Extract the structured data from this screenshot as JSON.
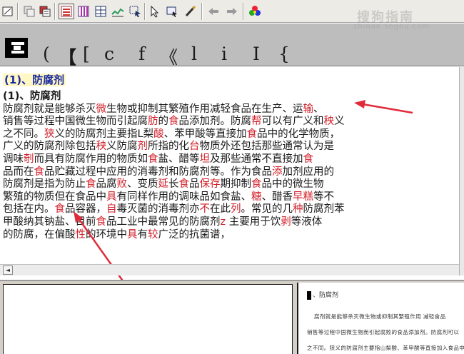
{
  "toolbar": {
    "buttons": [
      "frame-icon",
      "grid-icon",
      "grid-red-icon",
      "list-red-icon",
      "table-purple-icon",
      "table-blue-icon",
      "chart-icon",
      "select-icon",
      "pointer-icon",
      "region-icon",
      "pen-icon",
      "arrow-left-icon",
      "arrow-right-icon",
      "color-palette-icon"
    ]
  },
  "char_strip": {
    "chars": [
      "(",
      "【",
      "[",
      "c",
      "f",
      "《",
      "l",
      "i",
      "I",
      "{"
    ]
  },
  "text_pane": {
    "heading": "(1)、防腐剂",
    "subheading": "(1)、防腐剂",
    "lines": [
      [
        {
          "t": "    防腐剂就是能够杀灭"
        },
        {
          "t": "微",
          "r": true
        },
        {
          "t": "生物或抑制其繁殖作用减轻食品在生产、运"
        },
        {
          "t": "输",
          "r": true
        },
        {
          "t": "、"
        }
      ],
      [
        {
          "t": "销售等过程中国微生物而引起腐"
        },
        {
          "t": "肪",
          "r": true
        },
        {
          "t": "的"
        },
        {
          "t": "食",
          "r": true
        },
        {
          "t": "品添加剂。防腐"
        },
        {
          "t": "帮",
          "r": true
        },
        {
          "t": "可以有广义和"
        },
        {
          "t": "秧",
          "r": true
        },
        {
          "t": "义"
        }
      ],
      [
        {
          "t": "之不同。"
        },
        {
          "t": "狭",
          "r": true
        },
        {
          "t": "义的防腐剂主要指L梨"
        },
        {
          "t": "酸",
          "r": true
        },
        {
          "t": "、苯甲酸等直接加"
        },
        {
          "t": "食",
          "r": true
        },
        {
          "t": "品中的化学物质，"
        }
      ],
      [
        {
          "t": "广义的防腐剂除包括"
        },
        {
          "t": "秧",
          "r": true
        },
        {
          "t": "义防腐"
        },
        {
          "t": "剂",
          "r": true
        },
        {
          "t": "所指的化"
        },
        {
          "t": "台",
          "r": true
        },
        {
          "t": "物质外还包括那些通常认为是"
        }
      ],
      [
        {
          "t": "调味"
        },
        {
          "t": "剞",
          "r": true
        },
        {
          "t": "而具有防腐作用的物质如"
        },
        {
          "t": "食",
          "r": true
        },
        {
          "t": "盐、醋等"
        },
        {
          "t": "坦",
          "r": true
        },
        {
          "t": "及那些通常不直接加"
        },
        {
          "t": "食",
          "r": true
        }
      ],
      [
        {
          "t": "品而在"
        },
        {
          "t": "食",
          "r": true
        },
        {
          "t": "品贮藏过程中应用的消毒剂和防腐剂等。作为食品"
        },
        {
          "t": "添",
          "r": true
        },
        {
          "t": "加剂应用的"
        }
      ],
      [
        {
          "t": "防腐剂是指为防止"
        },
        {
          "t": "食",
          "r": true
        },
        {
          "t": "品腐"
        },
        {
          "t": "败",
          "r": true
        },
        {
          "t": "、变质"
        },
        {
          "t": "延",
          "r": true
        },
        {
          "t": "长"
        },
        {
          "t": "食",
          "r": true
        },
        {
          "t": "品"
        },
        {
          "t": "保存",
          "r": true
        },
        {
          "t": "期抑制"
        },
        {
          "t": "食",
          "r": true
        },
        {
          "t": "品中的微生物"
        }
      ],
      [
        {
          "t": "繁殖的物质但在食品中"
        },
        {
          "t": "具",
          "r": true
        },
        {
          "t": "有同样作用的调味品如食盐、"
        },
        {
          "t": "糖",
          "r": true
        },
        {
          "t": "、醋香"
        },
        {
          "t": "早糕",
          "r": true
        },
        {
          "t": "等不"
        }
      ],
      [
        {
          "t": "包括在内。"
        },
        {
          "t": "食",
          "r": true
        },
        {
          "t": "品容器，"
        },
        {
          "t": "自",
          "r": true
        },
        {
          "t": "毒灭菌的消毒剂亦"
        },
        {
          "t": "不",
          "r": true
        },
        {
          "t": "在此"
        },
        {
          "t": "列",
          "r": true
        },
        {
          "t": "。常见的几"
        },
        {
          "t": "种",
          "r": true
        },
        {
          "t": "防腐剂苯"
        }
      ],
      [
        {
          "t": "甲酸纳其钠盐、目前"
        },
        {
          "t": "食",
          "r": true
        },
        {
          "t": "品工业中最常见的防腐剂"
        },
        {
          "t": "z",
          "r": true
        },
        {
          "t": "  主要用于饮"
        },
        {
          "t": "剥",
          "r": true
        },
        {
          "t": "等液体"
        }
      ],
      [
        {
          "t": "的防腐，在偏酸"
        },
        {
          "t": "性",
          "r": true
        },
        {
          "t": "的环境中"
        },
        {
          "t": "具",
          "r": true
        },
        {
          "t": "有"
        },
        {
          "t": "较",
          "r": true
        },
        {
          "t": "广泛的抗菌谱，"
        }
      ]
    ]
  },
  "scrollbar": {
    "left_arrow": "◄"
  },
  "preview": {
    "heading": "、防腐剂",
    "lines": [
      "腐剂就是能够杀灭微生物或抑制其繁殖作用 减轻食品",
      "销售等过程中国微生物而引起腐败的食品添加剂。防腐剂可以",
      "之不同。狭义的防腐剂主要指山梨酸、苯甲酸等直接加入食品中"
    ],
    "watermark": "搜狗指南",
    "watermark_sub": "zhinan.sogou.com"
  }
}
